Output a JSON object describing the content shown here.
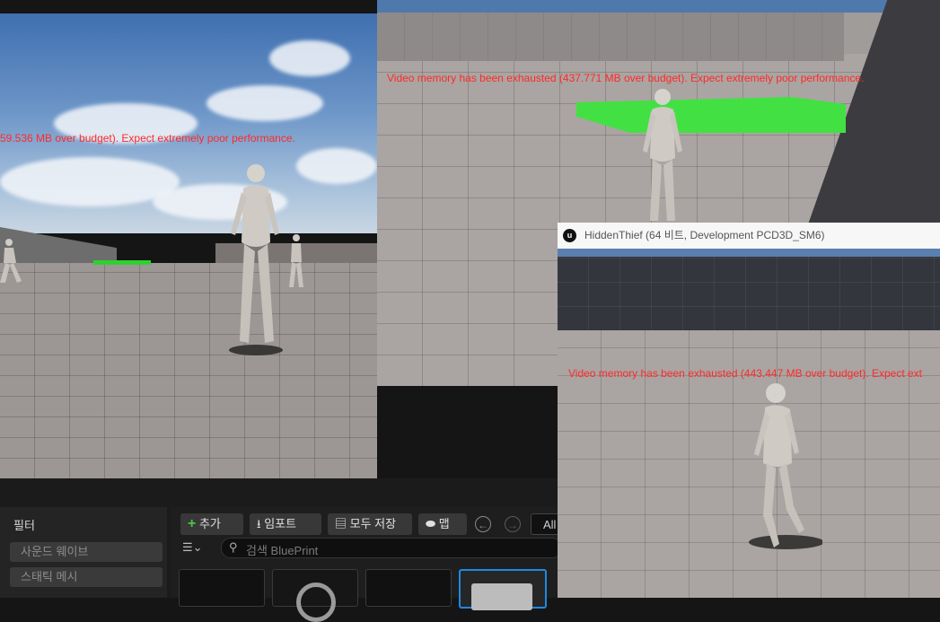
{
  "viewport_left": {
    "warning": "59.536 MB over budget). Expect extremely poor performance."
  },
  "viewport_center": {
    "warning": "Video memory has been exhausted (437.771 MB over budget). Expect extremely poor performance."
  },
  "game_window": {
    "icon": "unreal-engine-icon",
    "title": "HiddenThief (64 비트, Development PCD3D_SM6)",
    "warning": "Video memory has been exhausted (443.447 MB over budget). Expect ext"
  },
  "content_browser": {
    "filter_title": "필터",
    "filters": [
      "사운드 웨이브",
      "스태틱 메시"
    ],
    "toolbar": {
      "add": "추가",
      "import": "임포트",
      "save_all": "모두 저장",
      "map": "맵",
      "all": "All"
    },
    "search_placeholder": "검색 BluePrint"
  },
  "colors": {
    "warning": "#ff2a2a",
    "green_plus": "#4ec34e",
    "selected_thumb": "#1e88e5"
  }
}
